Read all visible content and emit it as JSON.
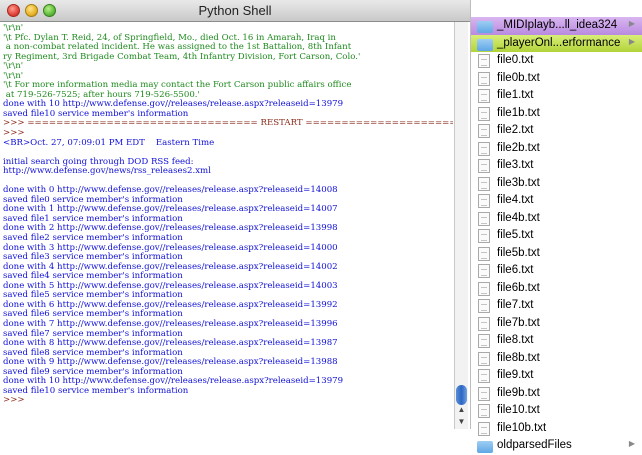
{
  "window": {
    "title": "Python Shell"
  },
  "shell_lines": [
    {
      "text": "'\\r\\n'",
      "kind": "out"
    },
    {
      "text": "'\\t Pfc. Dylan T. Reid, 24, of Springfield, Mo., died Oct. 16 in Amarah, Iraq in",
      "kind": "out"
    },
    {
      "text": " a non-combat related incident. He was assigned to the 1st Battalion, 8th Infant",
      "kind": "out"
    },
    {
      "text": "ry Regiment, 3rd Brigade Combat Team, 4th Infantry Division, Fort Carson, Colo.'",
      "kind": "out"
    },
    {
      "text": "'\\r\\n'",
      "kind": "out"
    },
    {
      "text": "'\\r\\n'",
      "kind": "out"
    },
    {
      "text": "'\\t For more information media may contact the Fort Carson public affairs office",
      "kind": "out"
    },
    {
      "text": " at 719-526-7525; after hours 719-526-5500.'",
      "kind": "out"
    },
    {
      "text": "done with 10 http://www.defense.gov//releases/release.aspx?releaseid=13979",
      "kind": "blue"
    },
    {
      "text": "saved file10 service member's information",
      "kind": "blue"
    },
    {
      "text": ">>> ================================ RESTART ================================",
      "kind": "prm"
    },
    {
      "text": ">>>",
      "kind": "prm"
    },
    {
      "text": "<BR>Oct. 27, 07:09:01 PM EDT    Eastern Time",
      "kind": "blue"
    },
    {
      "text": "",
      "kind": "blue"
    },
    {
      "text": "initial search going through DOD RSS feed:",
      "kind": "blue"
    },
    {
      "text": "http://www.defense.gov/news/rss_releases2.xml",
      "kind": "blue"
    },
    {
      "text": "",
      "kind": "blue"
    },
    {
      "text": "done with 0 http://www.defense.gov//releases/release.aspx?releaseid=14008",
      "kind": "blue"
    },
    {
      "text": "saved file0 service member's information",
      "kind": "blue"
    },
    {
      "text": "done with 1 http://www.defense.gov//releases/release.aspx?releaseid=14007",
      "kind": "blue"
    },
    {
      "text": "saved file1 service member's information",
      "kind": "blue"
    },
    {
      "text": "done with 2 http://www.defense.gov//releases/release.aspx?releaseid=13998",
      "kind": "blue"
    },
    {
      "text": "saved file2 service member's information",
      "kind": "blue"
    },
    {
      "text": "done with 3 http://www.defense.gov//releases/release.aspx?releaseid=14000",
      "kind": "blue"
    },
    {
      "text": "saved file3 service member's information",
      "kind": "blue"
    },
    {
      "text": "done with 4 http://www.defense.gov//releases/release.aspx?releaseid=14002",
      "kind": "blue"
    },
    {
      "text": "saved file4 service member's information",
      "kind": "blue"
    },
    {
      "text": "done with 5 http://www.defense.gov//releases/release.aspx?releaseid=14003",
      "kind": "blue"
    },
    {
      "text": "saved file5 service member's information",
      "kind": "blue"
    },
    {
      "text": "done with 6 http://www.defense.gov//releases/release.aspx?releaseid=13992",
      "kind": "blue"
    },
    {
      "text": "saved file6 service member's information",
      "kind": "blue"
    },
    {
      "text": "done with 7 http://www.defense.gov//releases/release.aspx?releaseid=13996",
      "kind": "blue"
    },
    {
      "text": "saved file7 service member's information",
      "kind": "blue"
    },
    {
      "text": "done with 8 http://www.defense.gov//releases/release.aspx?releaseid=13987",
      "kind": "blue"
    },
    {
      "text": "saved file8 service member's information",
      "kind": "blue"
    },
    {
      "text": "done with 9 http://www.defense.gov//releases/release.aspx?releaseid=13988",
      "kind": "blue"
    },
    {
      "text": "saved file9 service member's information",
      "kind": "blue"
    },
    {
      "text": "done with 10 http://www.defense.gov//releases/release.aspx?releaseid=13979",
      "kind": "blue"
    },
    {
      "text": "saved file10 service member's information",
      "kind": "blue"
    },
    {
      "text": ">>>",
      "kind": "prm"
    }
  ],
  "finder": {
    "items": [
      {
        "name": "_MIDIplayb...ll_idea324",
        "type": "folder",
        "label": "purple",
        "arrow": "▶"
      },
      {
        "name": "_playerOnl...erformance",
        "type": "folder",
        "label": "green",
        "arrow": "▶"
      },
      {
        "name": "file0.txt",
        "type": "file"
      },
      {
        "name": "file0b.txt",
        "type": "file"
      },
      {
        "name": "file1.txt",
        "type": "file"
      },
      {
        "name": "file1b.txt",
        "type": "file"
      },
      {
        "name": "file2.txt",
        "type": "file"
      },
      {
        "name": "file2b.txt",
        "type": "file"
      },
      {
        "name": "file3.txt",
        "type": "file"
      },
      {
        "name": "file3b.txt",
        "type": "file"
      },
      {
        "name": "file4.txt",
        "type": "file"
      },
      {
        "name": "file4b.txt",
        "type": "file"
      },
      {
        "name": "file5.txt",
        "type": "file"
      },
      {
        "name": "file5b.txt",
        "type": "file"
      },
      {
        "name": "file6.txt",
        "type": "file"
      },
      {
        "name": "file6b.txt",
        "type": "file"
      },
      {
        "name": "file7.txt",
        "type": "file"
      },
      {
        "name": "file7b.txt",
        "type": "file"
      },
      {
        "name": "file8.txt",
        "type": "file"
      },
      {
        "name": "file8b.txt",
        "type": "file"
      },
      {
        "name": "file9.txt",
        "type": "file"
      },
      {
        "name": "file9b.txt",
        "type": "file"
      },
      {
        "name": "file10.txt",
        "type": "file"
      },
      {
        "name": "file10b.txt",
        "type": "file"
      },
      {
        "name": "oldparsedFiles",
        "type": "folder",
        "arrow": "▶"
      }
    ]
  },
  "colors": {
    "output": "#1f8a1f",
    "prompt": "#8b2a1a",
    "stdout": "#1010d8"
  }
}
